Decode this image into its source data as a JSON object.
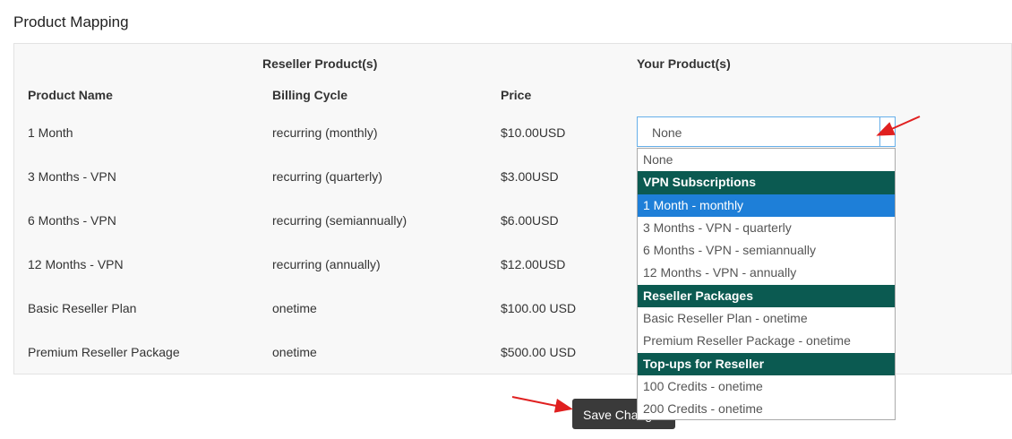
{
  "page": {
    "title": "Product Mapping"
  },
  "table": {
    "group_headers": {
      "reseller": "Reseller Product(s)",
      "yours": "Your Product(s)"
    },
    "columns": {
      "name": "Product Name",
      "cycle": "Billing Cycle",
      "price": "Price"
    },
    "rows": [
      {
        "name": "1 Month",
        "cycle": "recurring (monthly)",
        "price": "$10.00USD"
      },
      {
        "name": "3 Months - VPN",
        "cycle": "recurring (quarterly)",
        "price": "$3.00USD"
      },
      {
        "name": "6 Months - VPN",
        "cycle": "recurring (semiannually)",
        "price": "$6.00USD"
      },
      {
        "name": "12 Months - VPN",
        "cycle": "recurring (annually)",
        "price": "$12.00USD"
      },
      {
        "name": "Basic Reseller Plan",
        "cycle": "onetime",
        "price": "$100.00 USD"
      },
      {
        "name": "Premium Reseller Package",
        "cycle": "onetime",
        "price": "$500.00 USD"
      }
    ]
  },
  "product_select": {
    "value": "None",
    "options": [
      {
        "label": "None",
        "type": "option"
      },
      {
        "label": "VPN Subscriptions",
        "type": "group"
      },
      {
        "label": "1 Month - monthly",
        "type": "option",
        "highlighted": true
      },
      {
        "label": "3 Months - VPN - quarterly",
        "type": "option"
      },
      {
        "label": "6 Months - VPN - semiannually",
        "type": "option"
      },
      {
        "label": "12 Months - VPN - annually",
        "type": "option"
      },
      {
        "label": "Reseller Packages",
        "type": "group"
      },
      {
        "label": "Basic Reseller Plan - onetime",
        "type": "option"
      },
      {
        "label": "Premium Reseller Package - onetime",
        "type": "option"
      },
      {
        "label": "Top-ups for Reseller",
        "type": "group"
      },
      {
        "label": "100 Credits - onetime",
        "type": "option"
      },
      {
        "label": "200 Credits - onetime",
        "type": "option"
      }
    ]
  },
  "actions": {
    "save_label": "Save Changes"
  },
  "colors": {
    "group_header_bg": "#0b5a51",
    "highlight_bg": "#1e7fd8",
    "annotation_arrow": "#e02020"
  }
}
